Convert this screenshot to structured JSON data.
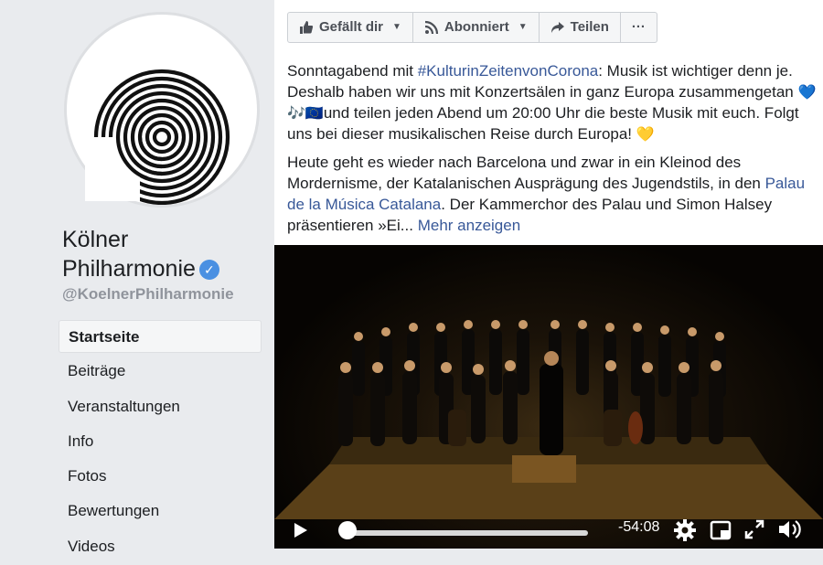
{
  "profile": {
    "name": "Kölner Philharmonie",
    "name_line1": "Kölner",
    "name_line2": "Philharmonie",
    "handle": "@KoelnerPhilharmonie",
    "add_icon": "plus-icon",
    "verified_icon": "check-icon"
  },
  "nav": {
    "items": [
      {
        "label": "Startseite",
        "active": true
      },
      {
        "label": "Beiträge"
      },
      {
        "label": "Veranstaltungen"
      },
      {
        "label": "Info"
      },
      {
        "label": "Fotos"
      },
      {
        "label": "Bewertungen"
      },
      {
        "label": "Videos"
      }
    ]
  },
  "actions": {
    "like_label": "Gefällt dir",
    "subscribe_label": "Abonniert",
    "share_label": "Teilen",
    "more_label": "···"
  },
  "post": {
    "p1_a": "Sonntagabend mit ",
    "p1_hashtag": "#KulturinZeitenvonCorona",
    "p1_b": ": Musik ist wichtiger denn je. Deshalb haben wir uns mit Konzertsälen in ganz Europa zusammengetan ",
    "p1_emojis": "💙🎶🇪🇺",
    "p1_c": "und teilen jeden Abend um 20:00 Uhr die beste Musik mit euch. Folgt uns bei dieser musikalischen Reise durch Europa! ",
    "p1_heart": "💛",
    "p2_a": "Heute geht es wieder nach Barcelona und zwar in ein Kleinod des Mordernisme, der Katalanischen Ausprägung des Jugendstils, in den ",
    "p2_link": "Palau de la Música Catalana",
    "p2_b": ". Der Kammerchor des Palau und Simon Halsey präsentieren »Ei... ",
    "more": "Mehr anzeigen"
  },
  "video": {
    "time_remaining": "-54:08",
    "progress": 0.02
  },
  "colors": {
    "accent": "#1877f2",
    "link": "#385898",
    "sidebar_bg": "#e9ebee"
  }
}
